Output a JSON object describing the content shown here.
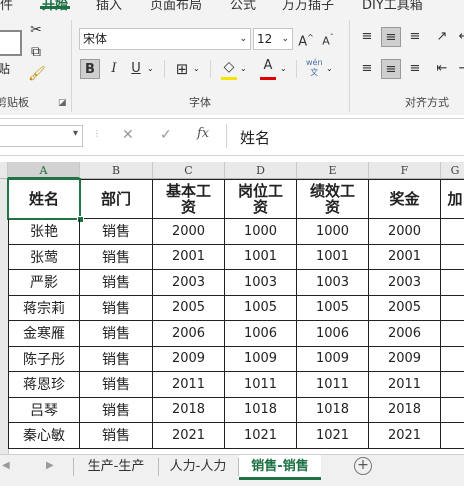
{
  "ribbon": {
    "tabs": [
      {
        "label": "件"
      },
      {
        "label": "开始"
      },
      {
        "label": "插入"
      },
      {
        "label": "页面布局"
      },
      {
        "label": "公式"
      },
      {
        "label": "万万插子"
      },
      {
        "label": "DIY工具箱"
      }
    ],
    "clipboard": {
      "paste_label": "贴",
      "group_label": "剪贴板"
    },
    "font": {
      "name": "宋体",
      "size": "12",
      "bold": "B",
      "italic": "I",
      "underline": "U",
      "font_color_glyph": "A",
      "wen_glyph": "wén\n文",
      "group_label": "字体"
    },
    "alignment": {
      "group_label": "对齐方式"
    }
  },
  "formula_bar": {
    "fx": "fx",
    "cancel": "✕",
    "enter": "✓",
    "content": "姓名"
  },
  "grid": {
    "columns": [
      "A",
      "B",
      "C",
      "D",
      "E",
      "F",
      "G"
    ],
    "header": [
      "姓名",
      "部门",
      "基本工资",
      "岗位工资",
      "绩效工资",
      "奖金",
      "加"
    ],
    "rows": [
      [
        "张艳",
        "销售",
        "2000",
        "1000",
        "1000",
        "2000",
        ""
      ],
      [
        "张莺",
        "销售",
        "2001",
        "1001",
        "1001",
        "2001",
        ""
      ],
      [
        "严影",
        "销售",
        "2003",
        "1003",
        "1003",
        "2003",
        ""
      ],
      [
        "蒋宗莉",
        "销售",
        "2005",
        "1005",
        "1005",
        "2005",
        ""
      ],
      [
        "金寒雁",
        "销售",
        "2006",
        "1006",
        "1006",
        "2006",
        ""
      ],
      [
        "陈子彤",
        "销售",
        "2009",
        "1009",
        "1009",
        "2009",
        ""
      ],
      [
        "蒋恩珍",
        "销售",
        "2011",
        "1011",
        "1011",
        "2011",
        ""
      ],
      [
        "吕琴",
        "销售",
        "2018",
        "1018",
        "1018",
        "2018",
        ""
      ],
      [
        "秦心敏",
        "销售",
        "2021",
        "1021",
        "1021",
        "2021",
        ""
      ]
    ]
  },
  "sheet_tabs": [
    {
      "label": "生产-生产"
    },
    {
      "label": "人力-人力"
    },
    {
      "label": "销售-销售"
    }
  ],
  "colors": {
    "accent": "#1e7145",
    "ribbon_bg": "#f3f3f3"
  }
}
